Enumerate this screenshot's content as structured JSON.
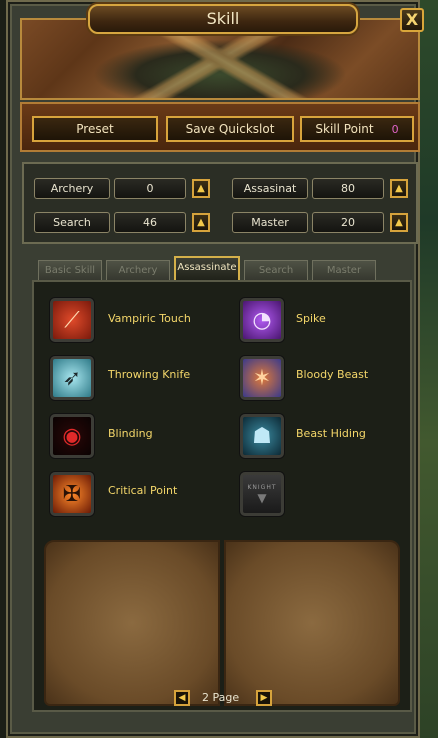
{
  "window": {
    "title": "Skill",
    "close_label": "X"
  },
  "toolbar": {
    "preset_label": "Preset",
    "save_quickslot_label": "Save Quickslot",
    "skill_point_label": "Skill Point",
    "skill_point_value": "0"
  },
  "stats": [
    {
      "name": "Archery",
      "value": "0",
      "up": "▲"
    },
    {
      "name": "Assasinat",
      "value": "80",
      "up": "▲"
    },
    {
      "name": "Search",
      "value": "46",
      "up": "▲"
    },
    {
      "name": "Master",
      "value": "20",
      "up": "▲"
    }
  ],
  "tabs": [
    {
      "label": "Basic Skill",
      "active": false
    },
    {
      "label": "Archery",
      "active": false
    },
    {
      "label": "Assassinate",
      "active": true
    },
    {
      "label": "Search",
      "active": false
    },
    {
      "label": "Master",
      "active": false
    }
  ],
  "skills": [
    {
      "name": "Vampiric Touch",
      "icon": "vampiric-touch-icon",
      "color": "#c0321c"
    },
    {
      "name": "Spike",
      "icon": "spike-icon",
      "color": "#6d2ab0"
    },
    {
      "name": "Throwing Knife",
      "icon": "throwing-knife-icon",
      "color": "#4aa0b0"
    },
    {
      "name": "Bloody Beast",
      "icon": "bloody-beast-icon",
      "color": "#c0562a"
    },
    {
      "name": "Blinding",
      "icon": "blinding-icon",
      "color": "#a01818"
    },
    {
      "name": "Beast Hiding",
      "icon": "beast-hiding-icon",
      "color": "#2e6f85"
    },
    {
      "name": "Critical Point",
      "icon": "critical-point-icon",
      "color": "#d4501a"
    },
    {
      "name": "",
      "icon": "knight-locked-icon",
      "color": "#555555",
      "icon_text": "KNIGHT"
    }
  ],
  "pager": {
    "prev": "◀",
    "next": "▶",
    "text": "2 Page"
  }
}
